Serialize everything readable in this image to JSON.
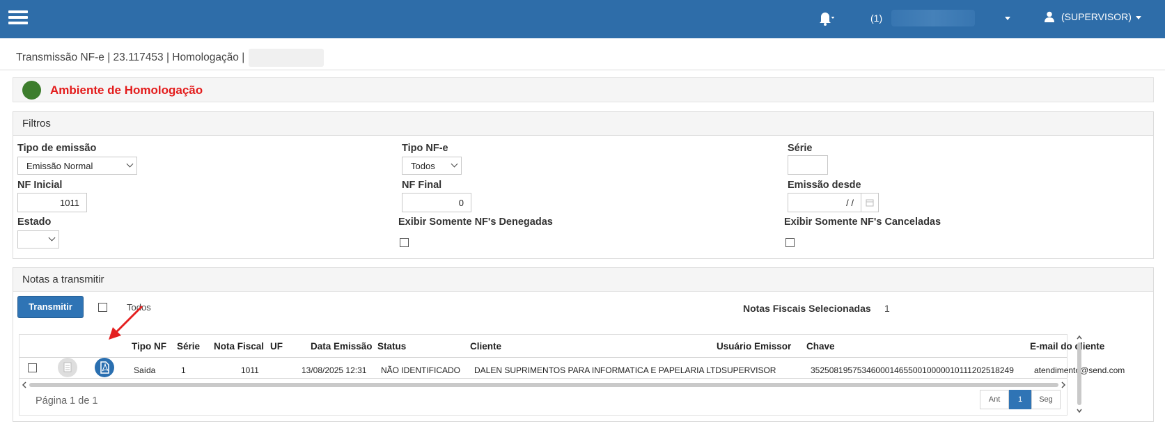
{
  "header": {
    "notification_count": "(1)",
    "user": "(SUPERVISOR)"
  },
  "breadcrumb": "Transmissão NF-e | 23.117453 | Homologação |",
  "ambiente": {
    "label": "Ambiente de Homologação",
    "status_color": "#3d7d2d",
    "label_color": "#e31b1b"
  },
  "filtros": {
    "title": "Filtros",
    "tipo_emissao": {
      "label": "Tipo de emissão",
      "value": "Emissão Normal"
    },
    "tipo_nfe": {
      "label": "Tipo NF-e",
      "value": "Todos"
    },
    "serie": {
      "label": "Série",
      "value": ""
    },
    "nf_inicial": {
      "label": "NF Inicial",
      "value": "1011"
    },
    "nf_final": {
      "label": "NF Final",
      "value": "0"
    },
    "emissao_desde": {
      "label": "Emissão desde",
      "value": "/ /"
    },
    "estado": {
      "label": "Estado",
      "value": ""
    },
    "denegadas": {
      "label": "Exibir Somente NF's Denegadas",
      "checked": false
    },
    "canceladas": {
      "label": "Exibir Somente NF's Canceladas",
      "checked": false
    }
  },
  "notas": {
    "title": "Notas a transmitir",
    "transmitir_label": "Transmitir",
    "todos_label": "Todos",
    "selecionadas_label": "Notas Fiscais Selecionadas",
    "selecionadas_count": "1",
    "columns": [
      "Tipo NF",
      "Série",
      "Nota Fiscal",
      "UF",
      "Data Emissão",
      "Status",
      "Cliente",
      "Usuário Emissor",
      "Chave",
      "E-mail do cliente"
    ],
    "row": {
      "tipo": "Saída",
      "serie": "1",
      "nota": "1011",
      "uf": "",
      "data": "13/08/2025 12:31",
      "status": "NÃO IDENTIFICADO",
      "cliente": "DALEN SUPRIMENTOS PARA INFORMATICA E PAPELARIA LTD",
      "usuario": "SUPERVISOR",
      "chave": "35250819575346000146550010000010111202518249",
      "email": "atendimento@send.com"
    },
    "page_info": "Página 1 de 1",
    "pager": {
      "prev": "Ant",
      "current": "1",
      "next": "Seg"
    }
  },
  "colors": {
    "topbar": "#2e6da9",
    "primary_button": "#2f74b5",
    "pdf_icon": "#2a6fb0"
  }
}
